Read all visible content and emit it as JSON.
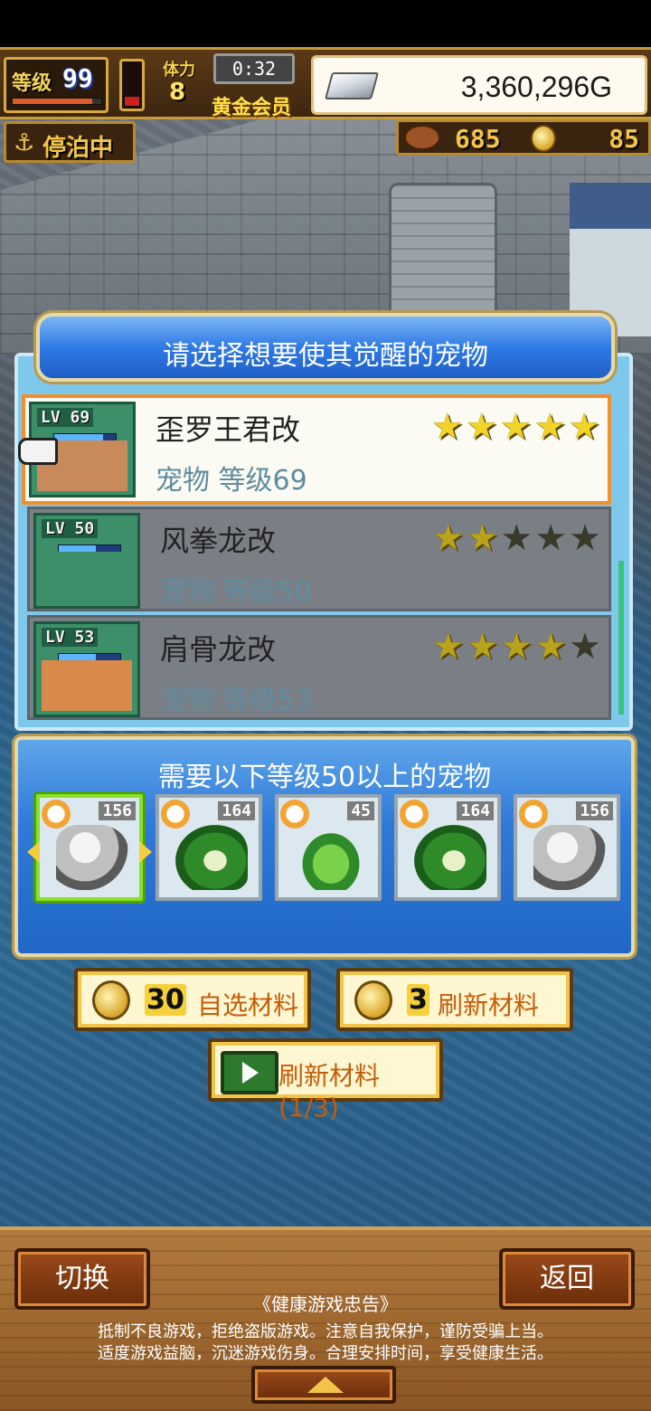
{
  "hud": {
    "level_label": "等级",
    "level_value": "99",
    "level_progress": 0.9,
    "vial_fill": 0.2,
    "crown_label": "体力",
    "crown_value": "8",
    "timer": "0:32",
    "vip_label": "黄金会员",
    "gold_value": "3,360,296G",
    "dock_label": "停泊中",
    "dock_icon": "anchor-icon",
    "meat_value": "685",
    "coin_value": "85"
  },
  "select_panel": {
    "title": "请选择想要使其觉醒的宠物",
    "pets": [
      {
        "lv": "LV 69",
        "name": "歪罗王君改",
        "sub": "宠物 等级69",
        "stars": 5,
        "max_stars": 5,
        "selected": true,
        "bar": 0.8
      },
      {
        "lv": "LV 50",
        "name": "风拳龙改",
        "sub": "宠物 等级50",
        "stars": 2,
        "max_stars": 5,
        "selected": false,
        "bar": 0.6
      },
      {
        "lv": "LV 53",
        "name": "肩骨龙改",
        "sub": "宠物 等级53",
        "stars": 4,
        "max_stars": 5,
        "selected": false,
        "bar": 0.6
      }
    ]
  },
  "requirement_panel": {
    "title": "需要以下等级50以上的宠物",
    "materials": [
      {
        "level": "156",
        "sprite": "knight",
        "active": true
      },
      {
        "level": "164",
        "sprite": "dragon",
        "active": false
      },
      {
        "level": "45",
        "sprite": "croc",
        "active": false
      },
      {
        "level": "164",
        "sprite": "dragon",
        "active": false
      },
      {
        "level": "156",
        "sprite": "knight",
        "active": false
      }
    ]
  },
  "buttons": {
    "select_mat_num": "30",
    "select_mat_label": "自选材料",
    "refresh_mat_num": "3",
    "refresh_mat_label": "刷新材料",
    "ad_refresh_label": "刷新材料(1/3)"
  },
  "bottom": {
    "switch_label": "切换",
    "back_label": "返回",
    "notice_title": "《健康游戏忠告》",
    "notice_line1": "抵制不良游戏，拒绝盗版游戏。注意自我保护，谨防受骗上当。",
    "notice_line2": "适度游戏益脑，沉迷游戏伤身。合理安排时间，享受健康生活。"
  },
  "colors": {
    "accent_gold": "#f2c44a",
    "selected_border": "#f28f2a",
    "panel_blue": "#2f79d8"
  }
}
